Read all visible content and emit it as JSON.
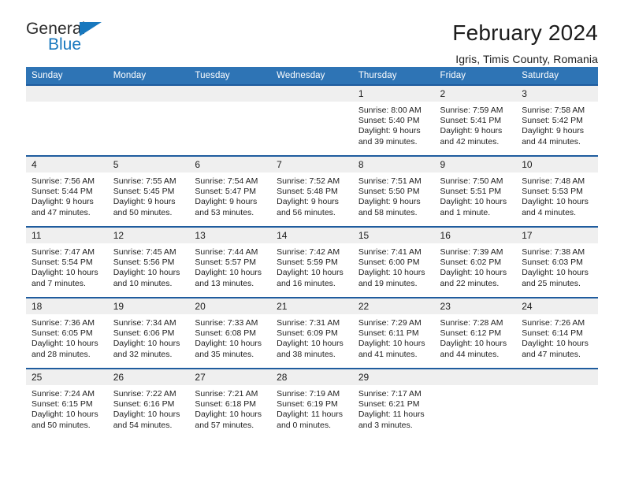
{
  "brand": {
    "name_top": "General",
    "name_bottom": "Blue",
    "accent_color": "#1878be"
  },
  "header": {
    "title": "February 2024",
    "subtitle": "Igris, Timis County, Romania"
  },
  "theme": {
    "header_blue": "#2e74b5",
    "rule_blue": "#1f5c9e",
    "daynum_band": "#efefef"
  },
  "labels": {
    "sunrise_prefix": "Sunrise:",
    "sunset_prefix": "Sunset:",
    "daylight_prefix": "Daylight:"
  },
  "weekday_headers": [
    "Sunday",
    "Monday",
    "Tuesday",
    "Wednesday",
    "Thursday",
    "Friday",
    "Saturday"
  ],
  "weeks": [
    [
      {
        "day": "",
        "empty": true
      },
      {
        "day": "",
        "empty": true
      },
      {
        "day": "",
        "empty": true
      },
      {
        "day": "",
        "empty": true
      },
      {
        "day": "1",
        "sunrise": "Sunrise: 8:00 AM",
        "sunset": "Sunset: 5:40 PM",
        "daylight": "Daylight: 9 hours and 39 minutes."
      },
      {
        "day": "2",
        "sunrise": "Sunrise: 7:59 AM",
        "sunset": "Sunset: 5:41 PM",
        "daylight": "Daylight: 9 hours and 42 minutes."
      },
      {
        "day": "3",
        "sunrise": "Sunrise: 7:58 AM",
        "sunset": "Sunset: 5:42 PM",
        "daylight": "Daylight: 9 hours and 44 minutes."
      }
    ],
    [
      {
        "day": "4",
        "sunrise": "Sunrise: 7:56 AM",
        "sunset": "Sunset: 5:44 PM",
        "daylight": "Daylight: 9 hours and 47 minutes."
      },
      {
        "day": "5",
        "sunrise": "Sunrise: 7:55 AM",
        "sunset": "Sunset: 5:45 PM",
        "daylight": "Daylight: 9 hours and 50 minutes."
      },
      {
        "day": "6",
        "sunrise": "Sunrise: 7:54 AM",
        "sunset": "Sunset: 5:47 PM",
        "daylight": "Daylight: 9 hours and 53 minutes."
      },
      {
        "day": "7",
        "sunrise": "Sunrise: 7:52 AM",
        "sunset": "Sunset: 5:48 PM",
        "daylight": "Daylight: 9 hours and 56 minutes."
      },
      {
        "day": "8",
        "sunrise": "Sunrise: 7:51 AM",
        "sunset": "Sunset: 5:50 PM",
        "daylight": "Daylight: 9 hours and 58 minutes."
      },
      {
        "day": "9",
        "sunrise": "Sunrise: 7:50 AM",
        "sunset": "Sunset: 5:51 PM",
        "daylight": "Daylight: 10 hours and 1 minute."
      },
      {
        "day": "10",
        "sunrise": "Sunrise: 7:48 AM",
        "sunset": "Sunset: 5:53 PM",
        "daylight": "Daylight: 10 hours and 4 minutes."
      }
    ],
    [
      {
        "day": "11",
        "sunrise": "Sunrise: 7:47 AM",
        "sunset": "Sunset: 5:54 PM",
        "daylight": "Daylight: 10 hours and 7 minutes."
      },
      {
        "day": "12",
        "sunrise": "Sunrise: 7:45 AM",
        "sunset": "Sunset: 5:56 PM",
        "daylight": "Daylight: 10 hours and 10 minutes."
      },
      {
        "day": "13",
        "sunrise": "Sunrise: 7:44 AM",
        "sunset": "Sunset: 5:57 PM",
        "daylight": "Daylight: 10 hours and 13 minutes."
      },
      {
        "day": "14",
        "sunrise": "Sunrise: 7:42 AM",
        "sunset": "Sunset: 5:59 PM",
        "daylight": "Daylight: 10 hours and 16 minutes."
      },
      {
        "day": "15",
        "sunrise": "Sunrise: 7:41 AM",
        "sunset": "Sunset: 6:00 PM",
        "daylight": "Daylight: 10 hours and 19 minutes."
      },
      {
        "day": "16",
        "sunrise": "Sunrise: 7:39 AM",
        "sunset": "Sunset: 6:02 PM",
        "daylight": "Daylight: 10 hours and 22 minutes."
      },
      {
        "day": "17",
        "sunrise": "Sunrise: 7:38 AM",
        "sunset": "Sunset: 6:03 PM",
        "daylight": "Daylight: 10 hours and 25 minutes."
      }
    ],
    [
      {
        "day": "18",
        "sunrise": "Sunrise: 7:36 AM",
        "sunset": "Sunset: 6:05 PM",
        "daylight": "Daylight: 10 hours and 28 minutes."
      },
      {
        "day": "19",
        "sunrise": "Sunrise: 7:34 AM",
        "sunset": "Sunset: 6:06 PM",
        "daylight": "Daylight: 10 hours and 32 minutes."
      },
      {
        "day": "20",
        "sunrise": "Sunrise: 7:33 AM",
        "sunset": "Sunset: 6:08 PM",
        "daylight": "Daylight: 10 hours and 35 minutes."
      },
      {
        "day": "21",
        "sunrise": "Sunrise: 7:31 AM",
        "sunset": "Sunset: 6:09 PM",
        "daylight": "Daylight: 10 hours and 38 minutes."
      },
      {
        "day": "22",
        "sunrise": "Sunrise: 7:29 AM",
        "sunset": "Sunset: 6:11 PM",
        "daylight": "Daylight: 10 hours and 41 minutes."
      },
      {
        "day": "23",
        "sunrise": "Sunrise: 7:28 AM",
        "sunset": "Sunset: 6:12 PM",
        "daylight": "Daylight: 10 hours and 44 minutes."
      },
      {
        "day": "24",
        "sunrise": "Sunrise: 7:26 AM",
        "sunset": "Sunset: 6:14 PM",
        "daylight": "Daylight: 10 hours and 47 minutes."
      }
    ],
    [
      {
        "day": "25",
        "sunrise": "Sunrise: 7:24 AM",
        "sunset": "Sunset: 6:15 PM",
        "daylight": "Daylight: 10 hours and 50 minutes."
      },
      {
        "day": "26",
        "sunrise": "Sunrise: 7:22 AM",
        "sunset": "Sunset: 6:16 PM",
        "daylight": "Daylight: 10 hours and 54 minutes."
      },
      {
        "day": "27",
        "sunrise": "Sunrise: 7:21 AM",
        "sunset": "Sunset: 6:18 PM",
        "daylight": "Daylight: 10 hours and 57 minutes."
      },
      {
        "day": "28",
        "sunrise": "Sunrise: 7:19 AM",
        "sunset": "Sunset: 6:19 PM",
        "daylight": "Daylight: 11 hours and 0 minutes."
      },
      {
        "day": "29",
        "sunrise": "Sunrise: 7:17 AM",
        "sunset": "Sunset: 6:21 PM",
        "daylight": "Daylight: 11 hours and 3 minutes."
      },
      {
        "day": "",
        "empty": true
      },
      {
        "day": "",
        "empty": true
      }
    ]
  ]
}
